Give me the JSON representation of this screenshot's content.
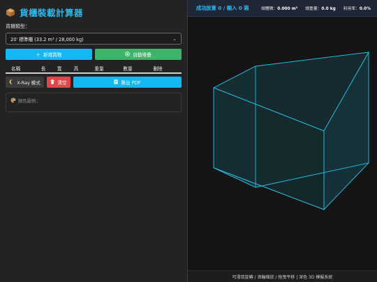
{
  "app": {
    "title": "貨櫃裝載計算器",
    "title_icon": "package-box-icon"
  },
  "container": {
    "label": "貨櫃類型：",
    "selected": "20' 標準櫃 (33.2 m³ / 28,000 kg)"
  },
  "buttons": {
    "add_label": "新增貨物",
    "add_icon": "plus-icon",
    "auto_label": "自動堆疊",
    "auto_icon": "target-icon",
    "xray_label": "X-Ray 模式",
    "xray_icon": "moon-icon",
    "clear_label": "清空",
    "clear_icon": "trash-icon",
    "pdf_label": "匯出 PDF",
    "pdf_icon": "document-icon"
  },
  "table": {
    "headers": [
      "名稱",
      "長",
      "寬",
      "高",
      "重量",
      "數量",
      "刪除"
    ],
    "rows": []
  },
  "legend": {
    "label": "顏色圖例：",
    "icon": "palette-icon"
  },
  "stats": {
    "status": "成功放置 0 / 輸入 0 箱",
    "volume_label": "總體積：",
    "volume_value": "0.000 m³",
    "weight_label": "總重量：",
    "weight_value": "0.0 kg",
    "util_label": "利用率：",
    "util_value": "0.0%"
  },
  "footer": {
    "text": "可滑鼠旋轉 / 滾輪縮放 / 拖曳平移 | 深色 3D 模擬系統"
  },
  "colors": {
    "accent": "#2bb7ea",
    "add_button": "#12b7f4",
    "auto_button": "#3db469",
    "clear_button": "#e0454a",
    "container_edge": "#22b8d8"
  }
}
